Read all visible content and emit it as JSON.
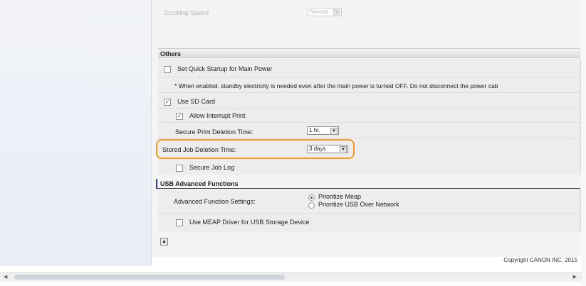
{
  "top": {
    "scrolling_speed_label": "Scrolling Speed",
    "scrolling_speed_value": "Normal"
  },
  "others": {
    "header": "Others",
    "quick_startup_label": "Set Quick Startup for Main Power",
    "quick_startup_note": "* When enabled, standby electricity is needed even after the main power is turned OFF. Do not disconnect the power cab",
    "use_sd_card_label": "Use SD Card",
    "allow_interrupt_label": "Allow Interrupt Print",
    "secure_print_label": "Secure Print Deletion Time:",
    "secure_print_value": "1 hr.",
    "stored_job_label": "Stored Job Deletion Time:",
    "stored_job_value": "3 days",
    "secure_job_log_label": "Secure Job Log"
  },
  "usb": {
    "header": "USB Advanced Functions",
    "advanced_label": "Advanced Function Settings:",
    "option_meap": "Prioritize Meap",
    "option_usb": "Prioritize USB Over Network",
    "meap_driver_label": "Use MEAP Driver for USB Storage Device"
  },
  "footer": {
    "copyright": "Copyright CANON INC. 2015"
  },
  "colors": {
    "highlight": "#f39a24",
    "usb_header_accent": "#2b3f8f"
  }
}
